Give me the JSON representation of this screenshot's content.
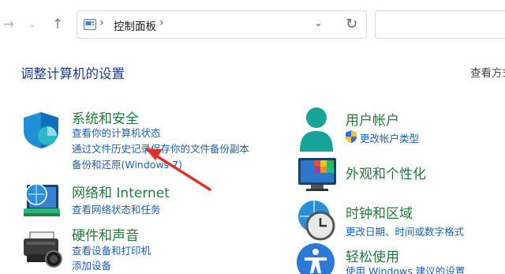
{
  "toolbar": {
    "forward_icon": "arrow-right-icon",
    "recent_icon": "chevron-down-icon",
    "up_icon": "arrow-up-icon",
    "address": {
      "separator": "›",
      "current": "控制面板",
      "trailing_separator": "›"
    },
    "search_placeholder": ""
  },
  "main": {
    "title": "调整计算机的设置",
    "view_by": "查看方式"
  },
  "categories_left": [
    {
      "title": "系统和安全",
      "icon": "shield-icon",
      "links": [
        "查看你的计算机状态",
        "通过文件历史记录保存你的文件备份副本",
        "备份和还原(Windows 7)"
      ]
    },
    {
      "title": "网络和 Internet",
      "icon": "globe-network-icon",
      "links": [
        "查看网络状态和任务"
      ]
    },
    {
      "title": "硬件和声音",
      "icon": "printer-icon",
      "links": [
        "查看设备和打印机",
        "添加设备"
      ]
    }
  ],
  "categories_right": [
    {
      "title": "用户帐户",
      "icon": "user-icon",
      "links": [
        "更改帐户类型"
      ]
    },
    {
      "title": "外观和个性化",
      "icon": "monitor-palette-icon",
      "links": []
    },
    {
      "title": "时钟和区域",
      "icon": "clock-globe-icon",
      "links": [
        "更改日期、时间或数字格式"
      ]
    },
    {
      "title": "轻松使用",
      "icon": "accessibility-icon",
      "links": [
        "使用 Windows 建议的设置"
      ]
    }
  ],
  "colors": {
    "title_blue": "#1e3b85",
    "category_green": "#1f7a39",
    "link_blue": "#1a5fb4",
    "annotation_arrow": "#e0312c"
  }
}
